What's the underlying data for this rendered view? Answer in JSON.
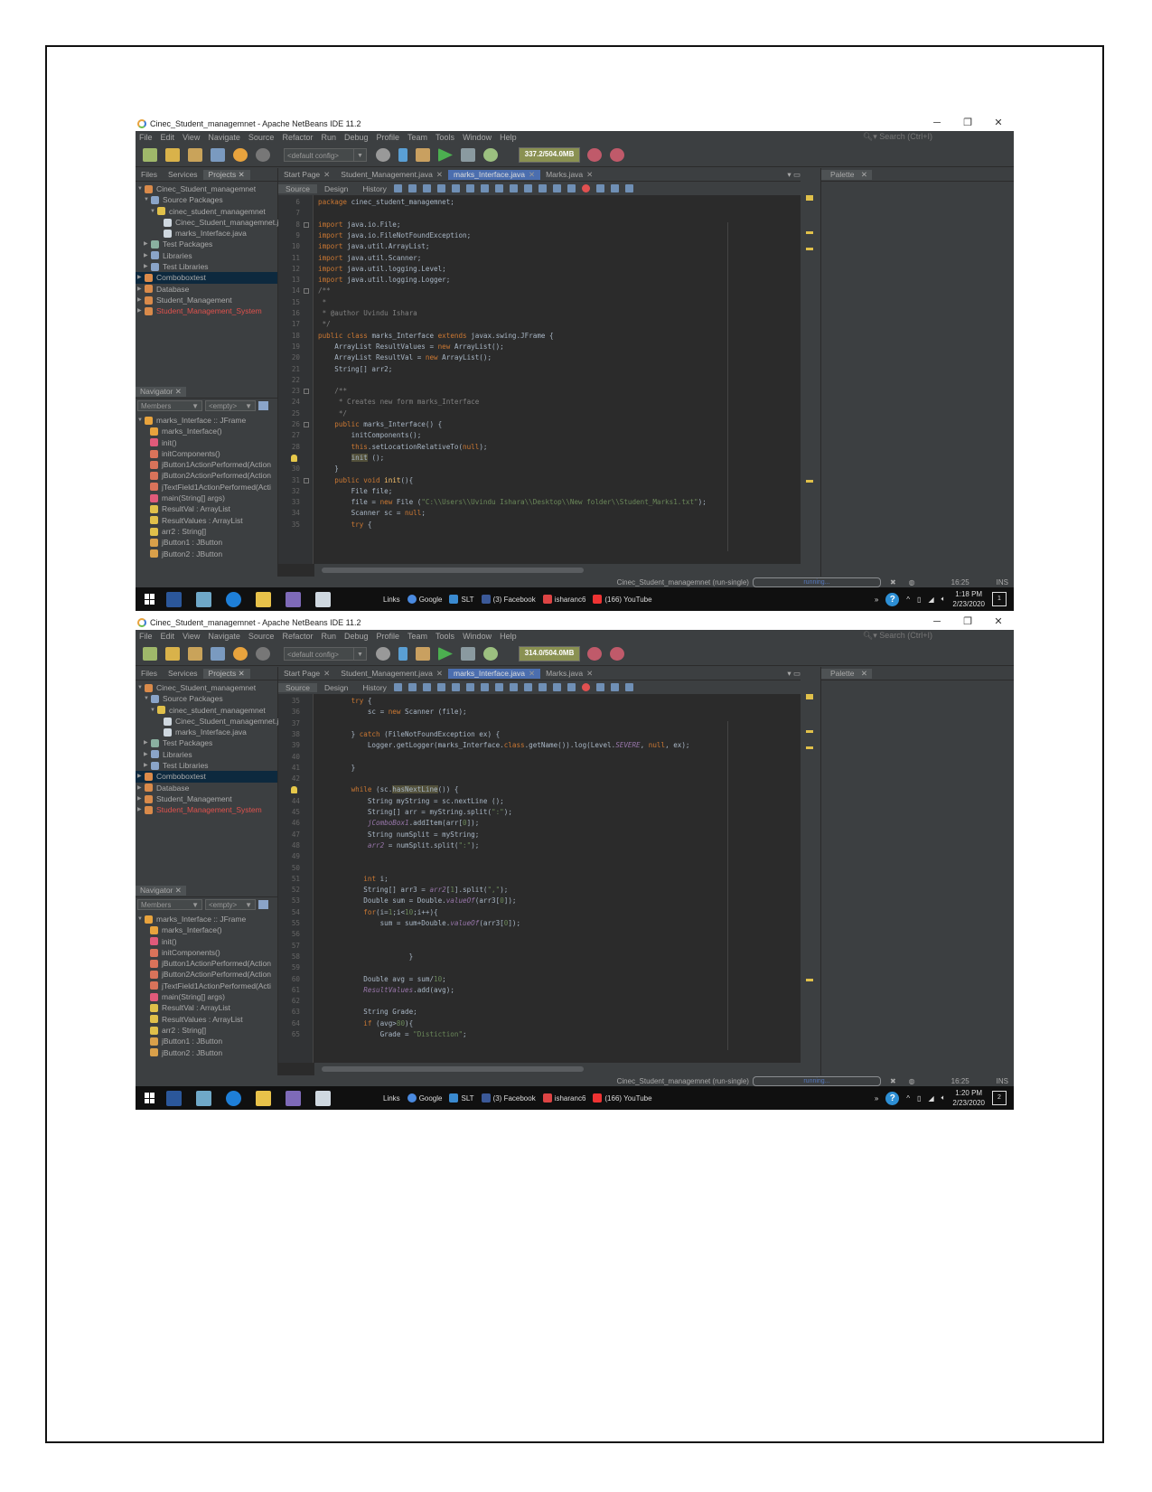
{
  "screenshots": [
    {
      "window_title": "Cinec_Student_managemnet - Apache NetBeans IDE 11.2",
      "window_controls": {
        "minimize": "─",
        "restore": "❐",
        "close": "✕"
      },
      "menu": [
        "File",
        "Edit",
        "View",
        "Navigate",
        "Source",
        "Refactor",
        "Run",
        "Debug",
        "Profile",
        "Team",
        "Tools",
        "Window",
        "Help"
      ],
      "search_placeholder": "Search (Ctrl+I)",
      "config": "<default config>",
      "memory": "337.2/504.0MB",
      "project_tabs": [
        "Files",
        "Services",
        "Projects"
      ],
      "project_tree": [
        {
          "label": "Cinec_Student_managemnet",
          "level": 0,
          "icon": "project-icon",
          "arrow": "▼"
        },
        {
          "label": "Source Packages",
          "level": 1,
          "icon": "source-packages-icon",
          "arrow": "▼"
        },
        {
          "label": "cinec_student_managemnet",
          "level": 2,
          "icon": "package-icon",
          "arrow": "▼"
        },
        {
          "label": "Cinec_Student_managemnet.ja",
          "level": 3,
          "icon": "java-file-icon",
          "arrow": ""
        },
        {
          "label": "marks_Interface.java",
          "level": 3,
          "icon": "java-file-icon",
          "arrow": ""
        },
        {
          "label": "Test Packages",
          "level": 1,
          "icon": "test-packages-icon",
          "arrow": "▶"
        },
        {
          "label": "Libraries",
          "level": 1,
          "icon": "libraries-icon",
          "arrow": "▶"
        },
        {
          "label": "Test Libraries",
          "level": 1,
          "icon": "libraries-icon",
          "arrow": "▶"
        },
        {
          "label": "Comboboxtest",
          "level": 0,
          "icon": "project-icon",
          "arrow": "▶",
          "selected": true
        },
        {
          "label": "Database",
          "level": 0,
          "icon": "project-icon",
          "arrow": "▶"
        },
        {
          "label": "Student_Management",
          "level": 0,
          "icon": "project-icon",
          "arrow": "▶"
        },
        {
          "label": "Student_Management_System",
          "level": 0,
          "icon": "project-icon",
          "arrow": "▶",
          "error": true
        }
      ],
      "navigator": {
        "title": "Navigator",
        "filter": "Members",
        "empty": "<empty>",
        "items": [
          {
            "label": "marks_Interface :: JFrame",
            "level": 0,
            "color": "#e8a33d"
          },
          {
            "label": "marks_Interface()",
            "level": 1,
            "color": "#e8a33d"
          },
          {
            "label": "init()",
            "level": 1,
            "color": "#e05a7a"
          },
          {
            "label": "initComponents()",
            "level": 1,
            "color": "#d9735a"
          },
          {
            "label": "jButton1ActionPerformed(Action",
            "level": 1,
            "color": "#d9735a"
          },
          {
            "label": "jButton2ActionPerformed(Action",
            "level": 1,
            "color": "#d9735a"
          },
          {
            "label": "jTextField1ActionPerformed(Acti",
            "level": 1,
            "color": "#d9735a"
          },
          {
            "label": "main(String[] args)",
            "level": 1,
            "color": "#e05a7a"
          },
          {
            "label": "ResultVal : ArrayList",
            "level": 1,
            "color": "#e0c04a"
          },
          {
            "label": "ResultValues : ArrayList",
            "level": 1,
            "color": "#e0c04a"
          },
          {
            "label": "arr2 : String[]",
            "level": 1,
            "color": "#e0c04a"
          },
          {
            "label": "jButton1 : JButton",
            "level": 1,
            "color": "#d9a04a"
          },
          {
            "label": "jButton2 : JButton",
            "level": 1,
            "color": "#d9a04a"
          }
        ]
      },
      "editor_tabs": [
        {
          "label": "Start Page",
          "active": false
        },
        {
          "label": "Student_Management.java",
          "active": false
        },
        {
          "label": "marks_Interface.java",
          "active": true
        },
        {
          "label": "Marks.java",
          "active": false
        }
      ],
      "view_tabs": [
        "Source",
        "Design",
        "History"
      ],
      "palette_title": "Palette",
      "code_lines": [
        {
          "n": "6",
          "html": "<span class='kw'>package</span> cinec_student_managemnet;"
        },
        {
          "n": "7",
          "html": ""
        },
        {
          "n": "8",
          "html": "<span class='kw'>import</span> java.io.File;",
          "fold": true
        },
        {
          "n": "9",
          "html": "<span class='kw'>import</span> java.io.FileNotFoundException;"
        },
        {
          "n": "10",
          "html": "<span class='kw'>import</span> java.util.ArrayList;"
        },
        {
          "n": "11",
          "html": "<span class='kw'>import</span> java.util.Scanner;"
        },
        {
          "n": "12",
          "html": "<span class='kw'>import</span> java.util.logging.Level;"
        },
        {
          "n": "13",
          "html": "<span class='kw'>import</span> java.util.logging.Logger;"
        },
        {
          "n": "14",
          "html": "<span class='cm'>/**</span>",
          "fold": true
        },
        {
          "n": "15",
          "html": "<span class='cm'> *</span>"
        },
        {
          "n": "16",
          "html": "<span class='cm'> * @author Uvindu Ishara</span>"
        },
        {
          "n": "17",
          "html": "<span class='cm'> */</span>"
        },
        {
          "n": "18",
          "html": "<span class='kw'>public class</span> marks_Interface <span class='kw'>extends</span> javax.swing.JFrame {"
        },
        {
          "n": "19",
          "html": "    ArrayList ResultValues = <span class='kw'>new</span> ArrayList();"
        },
        {
          "n": "20",
          "html": "    ArrayList ResultVal = <span class='kw'>new</span> ArrayList();"
        },
        {
          "n": "21",
          "html": "    String[] arr2;"
        },
        {
          "n": "22",
          "html": ""
        },
        {
          "n": "23",
          "html": "    <span class='cm'>/**</span>",
          "fold": true
        },
        {
          "n": "24",
          "html": "<span class='cm'>     * Creates new form marks_Interface</span>"
        },
        {
          "n": "25",
          "html": "<span class='cm'>     */</span>"
        },
        {
          "n": "26",
          "html": "    <span class='kw'>public</span> marks_Interface() {",
          "fold": true
        },
        {
          "n": "27",
          "html": "        initComponents();"
        },
        {
          "n": "28",
          "html": "        <span class='kw'>this</span>.setLocationRelativeTo(<span class='kw'>null</span>);"
        },
        {
          "n": "",
          "html": "        <span class='hl'>init</span> ();",
          "bulb": true
        },
        {
          "n": "30",
          "html": "    }"
        },
        {
          "n": "31",
          "html": "    <span class='kw'>public void</span> <span class='fn'>init</span>(){",
          "fold": true
        },
        {
          "n": "32",
          "html": "        File file;"
        },
        {
          "n": "33",
          "html": "        file = <span class='kw'>new</span> File (<span class='st'>\"C:\\\\Users\\\\Uvindu Ishara\\\\Desktop\\\\New folder\\\\Student_Marks1.txt\"</span>);"
        },
        {
          "n": "34",
          "html": "        Scanner sc = <span class='kw'>null</span>;"
        },
        {
          "n": "35",
          "html": "        <span class='kw'>try</span> {"
        }
      ],
      "status": {
        "project": "Cinec_Student_managemnet (run-single)",
        "progress": "running...",
        "position": "16:25",
        "mode": "INS"
      },
      "taskbar": {
        "links_label": "Links",
        "links": [
          "Google",
          "SLT",
          "(3) Facebook",
          "isharanc6",
          "(166) YouTube"
        ],
        "time": "1:18 PM",
        "date": "2/23/2020",
        "notifications": "1"
      }
    },
    {
      "window_title": "Cinec_Student_managemnet - Apache NetBeans IDE 11.2",
      "window_controls": {
        "minimize": "─",
        "restore": "❐",
        "close": "✕"
      },
      "menu": [
        "File",
        "Edit",
        "View",
        "Navigate",
        "Source",
        "Refactor",
        "Run",
        "Debug",
        "Profile",
        "Team",
        "Tools",
        "Window",
        "Help"
      ],
      "search_placeholder": "Search (Ctrl+I)",
      "config": "<default config>",
      "memory": "314.0/504.0MB",
      "project_tabs": [
        "Files",
        "Services",
        "Projects"
      ],
      "project_tree": [
        {
          "label": "Cinec_Student_managemnet",
          "level": 0,
          "icon": "project-icon",
          "arrow": "▼"
        },
        {
          "label": "Source Packages",
          "level": 1,
          "icon": "source-packages-icon",
          "arrow": "▼"
        },
        {
          "label": "cinec_student_managemnet",
          "level": 2,
          "icon": "package-icon",
          "arrow": "▼"
        },
        {
          "label": "Cinec_Student_managemnet.ja",
          "level": 3,
          "icon": "java-file-icon",
          "arrow": ""
        },
        {
          "label": "marks_Interface.java",
          "level": 3,
          "icon": "java-file-icon",
          "arrow": ""
        },
        {
          "label": "Test Packages",
          "level": 1,
          "icon": "test-packages-icon",
          "arrow": "▶"
        },
        {
          "label": "Libraries",
          "level": 1,
          "icon": "libraries-icon",
          "arrow": "▶"
        },
        {
          "label": "Test Libraries",
          "level": 1,
          "icon": "libraries-icon",
          "arrow": "▶"
        },
        {
          "label": "Comboboxtest",
          "level": 0,
          "icon": "project-icon",
          "arrow": "▶",
          "selected": true
        },
        {
          "label": "Database",
          "level": 0,
          "icon": "project-icon",
          "arrow": "▶"
        },
        {
          "label": "Student_Management",
          "level": 0,
          "icon": "project-icon",
          "arrow": "▶"
        },
        {
          "label": "Student_Management_System",
          "level": 0,
          "icon": "project-icon",
          "arrow": "▶",
          "error": true
        }
      ],
      "navigator": {
        "title": "Navigator",
        "filter": "Members",
        "empty": "<empty>",
        "items": [
          {
            "label": "marks_Interface :: JFrame",
            "level": 0,
            "color": "#e8a33d"
          },
          {
            "label": "marks_Interface()",
            "level": 1,
            "color": "#e8a33d"
          },
          {
            "label": "init()",
            "level": 1,
            "color": "#e05a7a"
          },
          {
            "label": "initComponents()",
            "level": 1,
            "color": "#d9735a"
          },
          {
            "label": "jButton1ActionPerformed(Action",
            "level": 1,
            "color": "#d9735a"
          },
          {
            "label": "jButton2ActionPerformed(Action",
            "level": 1,
            "color": "#d9735a"
          },
          {
            "label": "jTextField1ActionPerformed(Acti",
            "level": 1,
            "color": "#d9735a"
          },
          {
            "label": "main(String[] args)",
            "level": 1,
            "color": "#e05a7a"
          },
          {
            "label": "ResultVal : ArrayList",
            "level": 1,
            "color": "#e0c04a"
          },
          {
            "label": "ResultValues : ArrayList",
            "level": 1,
            "color": "#e0c04a"
          },
          {
            "label": "arr2 : String[]",
            "level": 1,
            "color": "#e0c04a"
          },
          {
            "label": "jButton1 : JButton",
            "level": 1,
            "color": "#d9a04a"
          },
          {
            "label": "jButton2 : JButton",
            "level": 1,
            "color": "#d9a04a"
          }
        ]
      },
      "editor_tabs": [
        {
          "label": "Start Page",
          "active": false
        },
        {
          "label": "Student_Management.java",
          "active": false
        },
        {
          "label": "marks_Interface.java",
          "active": true
        },
        {
          "label": "Marks.java",
          "active": false
        }
      ],
      "view_tabs": [
        "Source",
        "Design",
        "History"
      ],
      "palette_title": "Palette",
      "code_lines": [
        {
          "n": "35",
          "html": "        <span class='kw'>try</span> {"
        },
        {
          "n": "36",
          "html": "            sc = <span class='kw'>new</span> Scanner (file);"
        },
        {
          "n": "37",
          "html": ""
        },
        {
          "n": "38",
          "html": "        } <span class='kw'>catch</span> (FileNotFoundException ex) {"
        },
        {
          "n": "39",
          "html": "            Logger.getLogger(marks_Interface.<span class='kw'>class</span>.getName()).log(Level.<span class='it'>SEVERE</span>, <span class='kw'>null</span>, ex);"
        },
        {
          "n": "40",
          "html": ""
        },
        {
          "n": "41",
          "html": "        }"
        },
        {
          "n": "42",
          "html": ""
        },
        {
          "n": "",
          "html": "        <span class='kw'>while</span> (sc.<span class='hl'>hasNextLine</span>()) {",
          "bulb": true
        },
        {
          "n": "44",
          "html": "            String myString = sc.nextLine ();"
        },
        {
          "n": "45",
          "html": "            String[] arr = myString.split(<span class='st'>\":\"</span>);"
        },
        {
          "n": "46",
          "html": "            <span class='it'>jComboBox1</span>.addItem(arr[<span class='st'>0</span>]);"
        },
        {
          "n": "47",
          "html": "            String numSplit = myString;"
        },
        {
          "n": "48",
          "html": "            <span class='it'>arr2</span> = numSplit.split(<span class='st'>\":\"</span>);"
        },
        {
          "n": "49",
          "html": ""
        },
        {
          "n": "50",
          "html": ""
        },
        {
          "n": "51",
          "html": "           <span class='kw'>int</span> i;"
        },
        {
          "n": "52",
          "html": "           String[] arr3 = <span class='it'>arr2</span>[<span class='st'>1</span>].split(<span class='st'>\",\"</span>);"
        },
        {
          "n": "53",
          "html": "           Double sum = Double.<span class='it'>valueOf</span>(arr3[<span class='st'>0</span>]);"
        },
        {
          "n": "54",
          "html": "           <span class='kw'>for</span>(i=<span class='st'>1</span>;i&lt;<span class='st'>10</span>;i++){"
        },
        {
          "n": "55",
          "html": "               sum = sum+Double.<span class='it'>valueOf</span>(arr3[<span class='st'>0</span>]);"
        },
        {
          "n": "56",
          "html": ""
        },
        {
          "n": "57",
          "html": ""
        },
        {
          "n": "58",
          "html": "                      }"
        },
        {
          "n": "59",
          "html": ""
        },
        {
          "n": "60",
          "html": "           Double avg = sum/<span class='st'>10</span>;"
        },
        {
          "n": "61",
          "html": "           <span class='it'>ResultValues</span>.add(avg);"
        },
        {
          "n": "62",
          "html": ""
        },
        {
          "n": "63",
          "html": "           String Grade;"
        },
        {
          "n": "64",
          "html": "           <span class='kw'>if</span> (avg&gt;<span class='st'>80</span>){"
        },
        {
          "n": "65",
          "html": "               Grade = <span class='st'>\"Distiction\"</span>;"
        }
      ],
      "status": {
        "project": "Cinec_Student_managemnet (run-single)",
        "progress": "running...",
        "position": "16:25",
        "mode": "INS"
      },
      "taskbar": {
        "links_label": "Links",
        "links": [
          "Google",
          "SLT",
          "(3) Facebook",
          "isharanc6",
          "(166) YouTube"
        ],
        "time": "1:20 PM",
        "date": "2/23/2020",
        "notifications": "2"
      }
    }
  ]
}
